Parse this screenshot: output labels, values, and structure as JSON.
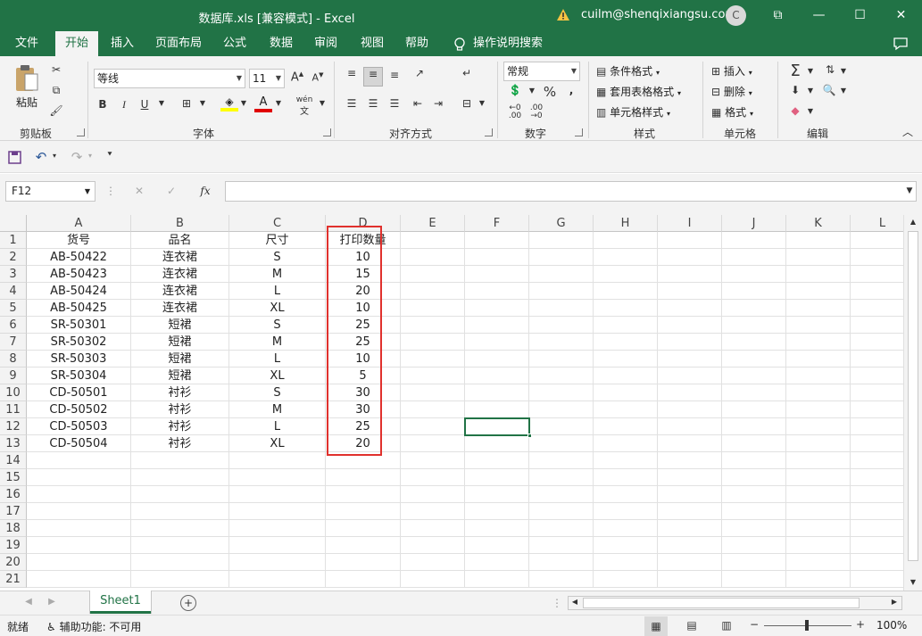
{
  "window": {
    "title": "数据库.xls  [兼容模式]  -  Excel",
    "user_email": "cuilm@shenqixiangsu.com",
    "avatar_initial": "C",
    "controls": {
      "ribbon_options": "⧉",
      "minimize": "—",
      "maximize": "☐",
      "close": "✕"
    }
  },
  "menu_tabs": [
    "文件",
    "开始",
    "插入",
    "页面布局",
    "公式",
    "数据",
    "审阅",
    "视图",
    "帮助"
  ],
  "tell_me": "操作说明搜索",
  "ribbon": {
    "clipboard": {
      "paste": "粘贴",
      "label": "剪贴板"
    },
    "font": {
      "name": "等线",
      "size": "11",
      "bold": "B",
      "italic": "I",
      "underline": "U",
      "phonetic": "wén",
      "label": "字体"
    },
    "alignment": {
      "label": "对齐方式"
    },
    "number": {
      "format": "常规",
      "percent": "%",
      "label": "数字"
    },
    "styles": {
      "conditional": "条件格式",
      "table": "套用表格格式",
      "cell_styles": "单元格样式",
      "label": "样式"
    },
    "cells": {
      "insert": "插入",
      "delete": "删除",
      "format": "格式",
      "label": "单元格"
    },
    "editing": {
      "label": "编辑"
    }
  },
  "formula_bar": {
    "name_box": "F12",
    "fx": "fx",
    "value": ""
  },
  "sheet": {
    "columns": [
      "A",
      "B",
      "C",
      "D",
      "E",
      "F",
      "G",
      "H",
      "I",
      "J",
      "K",
      "L"
    ],
    "rows": [
      "1",
      "2",
      "3",
      "4",
      "5",
      "6",
      "7",
      "8",
      "9",
      "10",
      "11",
      "12",
      "13",
      "14",
      "15",
      "16",
      "17",
      "18",
      "19",
      "20",
      "21"
    ],
    "cells": [
      [
        "货号",
        "品名",
        "尺寸",
        "打印数量"
      ],
      [
        "AB-50422",
        "连衣裙",
        "S",
        "10"
      ],
      [
        "AB-50423",
        "连衣裙",
        "M",
        "15"
      ],
      [
        "AB-50424",
        "连衣裙",
        "L",
        "20"
      ],
      [
        "AB-50425",
        "连衣裙",
        "XL",
        "10"
      ],
      [
        "SR-50301",
        "短裙",
        "S",
        "25"
      ],
      [
        "SR-50302",
        "短裙",
        "M",
        "25"
      ],
      [
        "SR-50303",
        "短裙",
        "L",
        "10"
      ],
      [
        "SR-50304",
        "短裙",
        "XL",
        "5"
      ],
      [
        "CD-50501",
        "衬衫",
        "S",
        "30"
      ],
      [
        "CD-50502",
        "衬衫",
        "M",
        "30"
      ],
      [
        "CD-50503",
        "衬衫",
        "L",
        "25"
      ],
      [
        "CD-50504",
        "衬衫",
        "XL",
        "20"
      ]
    ],
    "selected_cell": "F12"
  },
  "sheet_tabs": [
    "Sheet1"
  ],
  "status": {
    "ready": "就绪",
    "accessibility": "辅助功能: 不可用",
    "zoom": "100%"
  },
  "colors": {
    "brand": "#217346",
    "highlight_border": "#e0312d"
  }
}
